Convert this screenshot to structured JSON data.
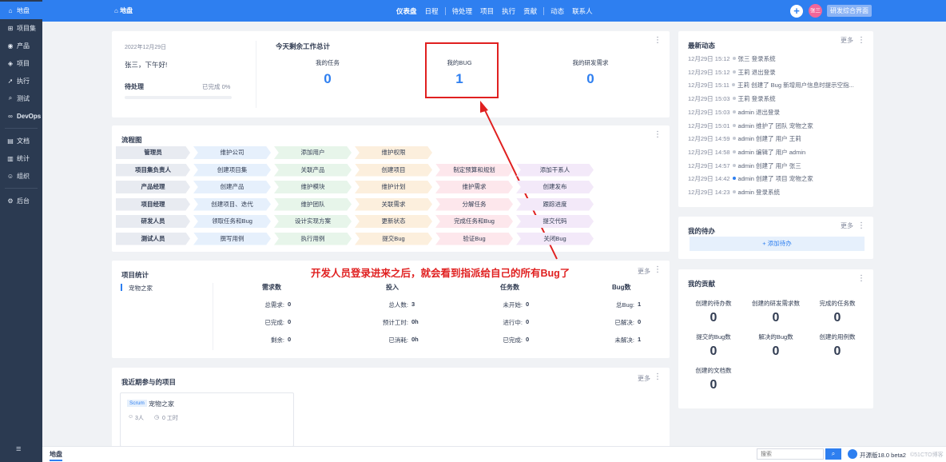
{
  "sidebar": {
    "items": [
      {
        "label": "地盘",
        "icon": "home-icon"
      },
      {
        "label": "项目集",
        "icon": "grid-icon"
      },
      {
        "label": "产品",
        "icon": "location-icon"
      },
      {
        "label": "项目",
        "icon": "cube-icon"
      },
      {
        "label": "执行",
        "icon": "run-icon"
      },
      {
        "label": "测试",
        "icon": "search-icon"
      },
      {
        "label": "DevOps",
        "icon": "infinity-icon"
      },
      {
        "label": "文档",
        "icon": "doc-icon"
      },
      {
        "label": "统计",
        "icon": "chart-icon"
      },
      {
        "label": "组织",
        "icon": "people-icon"
      },
      {
        "label": "后台",
        "icon": "gear-icon"
      }
    ],
    "menu_icon": "menu-icon"
  },
  "topbar": {
    "home": "地盘",
    "nav": [
      "仪表盘",
      "日程",
      "待处理",
      "项目",
      "执行",
      "贡献",
      "动态",
      "联系人"
    ],
    "avatar": "张三",
    "rd_button": "研发综合界面"
  },
  "welcome": {
    "date": "2022年12月29日",
    "greeting": "张三，下午好!",
    "pending_label": "待处理",
    "progress_text": "已完成 0%",
    "progress": 0
  },
  "work_total": {
    "title": "今天剩余工作总计",
    "items": [
      {
        "label": "我的任务",
        "value": "0"
      },
      {
        "label": "我的BUG",
        "value": "1"
      },
      {
        "label": "我的研发需求",
        "value": "0"
      }
    ]
  },
  "flow": {
    "title": "流程图",
    "rows": [
      {
        "role": "管理员",
        "steps": [
          "维护公司",
          "添加用户",
          "维护权限"
        ]
      },
      {
        "role": "项目集负责人",
        "steps": [
          "创建项目集",
          "关联产品",
          "创建项目",
          "制定预算和规划",
          "添加干系人"
        ]
      },
      {
        "role": "产品经理",
        "steps": [
          "创建产品",
          "维护模块",
          "维护计划",
          "维护需求",
          "创建发布"
        ]
      },
      {
        "role": "项目经理",
        "steps": [
          "创建项目、迭代",
          "维护团队",
          "关联需求",
          "分解任务",
          "跟踪进度"
        ]
      },
      {
        "role": "研发人员",
        "steps": [
          "领取任务和Bug",
          "设计实现方案",
          "更新状态",
          "完成任务和Bug",
          "提交代码"
        ]
      },
      {
        "role": "测试人员",
        "steps": [
          "撰写用例",
          "执行用例",
          "提交Bug",
          "验证Bug",
          "关闭Bug"
        ]
      }
    ]
  },
  "project_stats": {
    "title": "项目统计",
    "more": "更多",
    "project": "宠物之家",
    "columns": [
      {
        "header": "需求数",
        "rows": [
          {
            "k": "总需求",
            "v": "0"
          },
          {
            "k": "已完成",
            "v": "0"
          },
          {
            "k": "剩余",
            "v": "0"
          }
        ]
      },
      {
        "header": "投入",
        "rows": [
          {
            "k": "总人数",
            "v": "3"
          },
          {
            "k": "预计工时",
            "v": "0h"
          },
          {
            "k": "已消耗",
            "v": "0h"
          }
        ]
      },
      {
        "header": "任务数",
        "rows": [
          {
            "k": "未开始",
            "v": "0"
          },
          {
            "k": "进行中",
            "v": "0"
          },
          {
            "k": "已完成",
            "v": "0"
          }
        ]
      },
      {
        "header": "Bug数",
        "rows": [
          {
            "k": "总Bug",
            "v": "1"
          },
          {
            "k": "已解决",
            "v": "0"
          },
          {
            "k": "未解决",
            "v": "1"
          }
        ]
      }
    ]
  },
  "recent_projects": {
    "title": "我近期参与的项目",
    "more": "更多",
    "card": {
      "badge": "Scrum",
      "name": "宠物之家",
      "members": "3人",
      "hours": "0 工时"
    }
  },
  "dynamics": {
    "title": "最新动态",
    "more": "更多",
    "items": [
      {
        "time": "12月29日 15:12",
        "text": "张三 登录系统"
      },
      {
        "time": "12月29日 15:12",
        "text": "王莉 退出登录"
      },
      {
        "time": "12月29日 15:11",
        "text": "王莉 创建了 Bug 新增用户信息时提示空指..."
      },
      {
        "time": "12月29日 15:03",
        "text": "王莉 登录系统"
      },
      {
        "time": "12月29日 15:03",
        "text": "admin 退出登录"
      },
      {
        "time": "12月29日 15:01",
        "text": "admin 维护了 团队 宠物之家"
      },
      {
        "time": "12月29日 14:59",
        "text": "admin 创建了 用户 王莉"
      },
      {
        "time": "12月29日 14:58",
        "text": "admin 编辑了 用户 admin"
      },
      {
        "time": "12月29日 14:57",
        "text": "admin 创建了 用户 张三"
      },
      {
        "time": "12月29日 14:42",
        "text": "admin 创建了 项目 宠物之家"
      },
      {
        "time": "12月29日 14:23",
        "text": "admin 登录系统"
      }
    ]
  },
  "todo": {
    "title": "我的待办",
    "more": "更多",
    "add": "+ 添加待办"
  },
  "contribution": {
    "title": "我的贡献",
    "items": [
      {
        "label": "创建的待办数",
        "value": "0"
      },
      {
        "label": "创建的研发需求数",
        "value": "0"
      },
      {
        "label": "完成的任务数",
        "value": "0"
      },
      {
        "label": "提交的Bug数",
        "value": "0"
      },
      {
        "label": "解决的Bug数",
        "value": "0"
      },
      {
        "label": "创建的用例数",
        "value": "0"
      },
      {
        "label": "创建的文档数",
        "value": "0"
      }
    ]
  },
  "annotation": "开发人员登录进来之后，就会看到指派给自己的所有Bug了",
  "footer": {
    "tab": "地盘",
    "search_placeholder": "搜索",
    "version": "开源版18.0 beta2",
    "watermark": "©51CTO博客"
  },
  "colors": {
    "primary": "#2e7ff0",
    "sidebar": "#2b3a51",
    "annotation": "#e02020"
  }
}
